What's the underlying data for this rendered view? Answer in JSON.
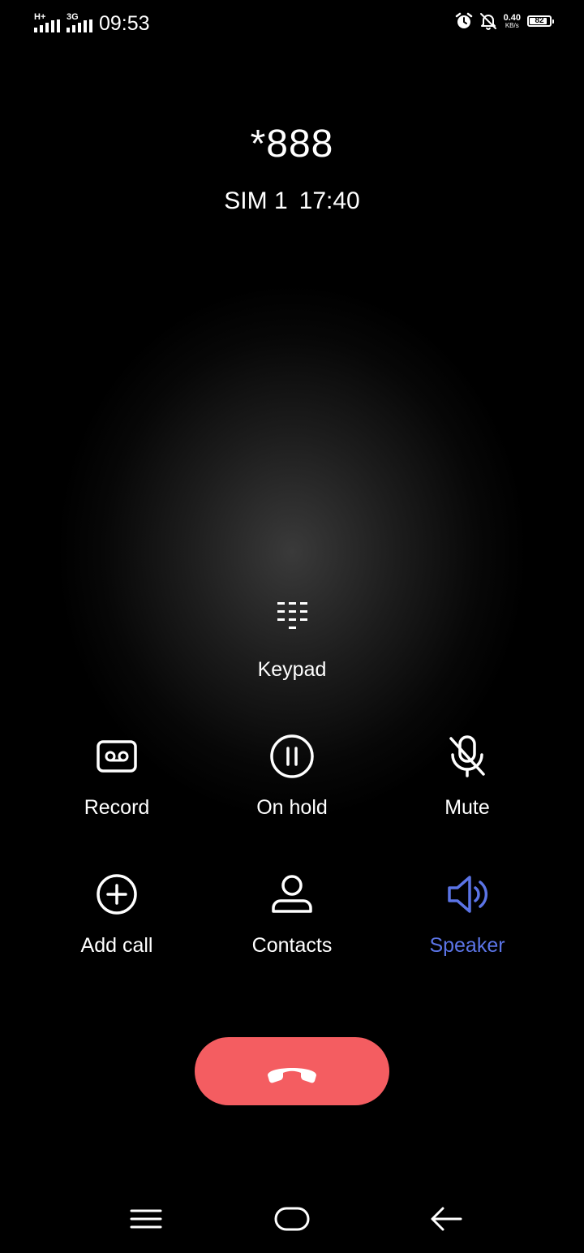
{
  "status_bar": {
    "signal1_tag": "H+",
    "signal2_tag": "3G",
    "time": "09:53",
    "net_speed_value": "0.40",
    "net_speed_unit": "KB/s",
    "battery_level": "82",
    "icons": [
      "alarm-icon",
      "mute-notifications-icon",
      "battery-icon"
    ]
  },
  "call": {
    "number": "*888",
    "sim": "SIM 1",
    "duration": "17:40"
  },
  "controls": {
    "keypad": {
      "label": "Keypad",
      "icon": "keypad-icon"
    },
    "record": {
      "label": "Record",
      "icon": "record-icon"
    },
    "hold": {
      "label": "On hold",
      "icon": "pause-icon"
    },
    "mute": {
      "label": "Mute",
      "icon": "mic-off-icon"
    },
    "add_call": {
      "label": "Add call",
      "icon": "plus-circle-icon"
    },
    "contacts": {
      "label": "Contacts",
      "icon": "person-icon"
    },
    "speaker": {
      "label": "Speaker",
      "icon": "speaker-icon",
      "active": true
    }
  },
  "end_call": {
    "icon": "end-call-icon"
  },
  "nav": [
    "menu-icon",
    "home-icon",
    "back-icon"
  ],
  "colors": {
    "background": "#000000",
    "accent": "#5b74e6",
    "end_call": "#f45d61",
    "text": "#ffffff"
  }
}
